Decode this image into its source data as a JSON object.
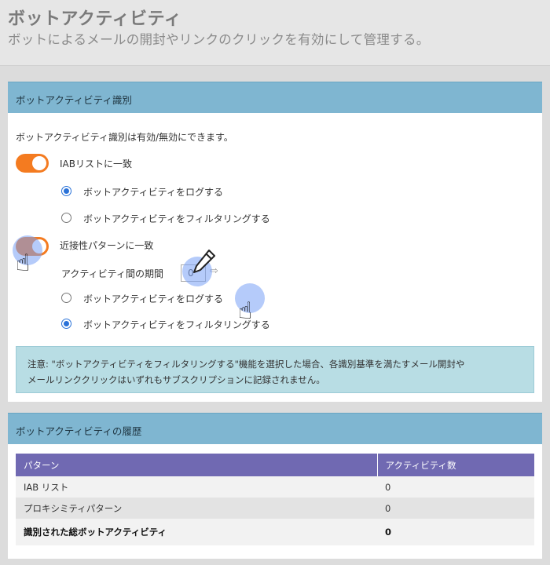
{
  "header": {
    "title": "ボットアクティビティ",
    "subtitle": "ボットによるメールの開封やリンクのクリックを有効にして管理する。"
  },
  "identification": {
    "title": "ボットアクティビティ識別",
    "description": "ボットアクティビティ識別は有効/無効にできます。",
    "iab": {
      "label": "IABリストに一致",
      "enabled": true,
      "options": [
        {
          "label": "ボットアクティビティをログする",
          "selected": true
        },
        {
          "label": "ボットアクティビティをフィルタリングする",
          "selected": false
        }
      ]
    },
    "proximity": {
      "label": "近接性パターンに一致",
      "enabled": true,
      "interval_label": "アクティビティ間の期間",
      "interval_value": "0",
      "options": [
        {
          "label": "ボットアクティビティをログする",
          "selected": false
        },
        {
          "label": "ボットアクティビティをフィルタリングする",
          "selected": true
        }
      ]
    },
    "note_line1": "注意: \"ボットアクティビティをフィルタリングする\"機能を選択した場合、各識別基準を満たすメール開封や",
    "note_line2": "メールリンククリックはいずれもサブスクリプションに記録されません。"
  },
  "history": {
    "title": "ボットアクティビティの履歴",
    "columns": [
      "パターン",
      "アクティビティ数"
    ],
    "rows": [
      {
        "pattern": "IAB リスト",
        "count": "0"
      },
      {
        "pattern": "プロキシミティパターン",
        "count": "0"
      }
    ],
    "total": {
      "label": "識別された総ボットアクティビティ",
      "count": "0"
    }
  },
  "colors": {
    "toggle_on": "#f47b20",
    "panel_header": "#7fb6d1",
    "table_header": "#7069b2",
    "note_bg": "#b8dde4"
  },
  "icons": [
    "pencil-icon",
    "hand-pointer-icon",
    "arrow-right-icon"
  ]
}
